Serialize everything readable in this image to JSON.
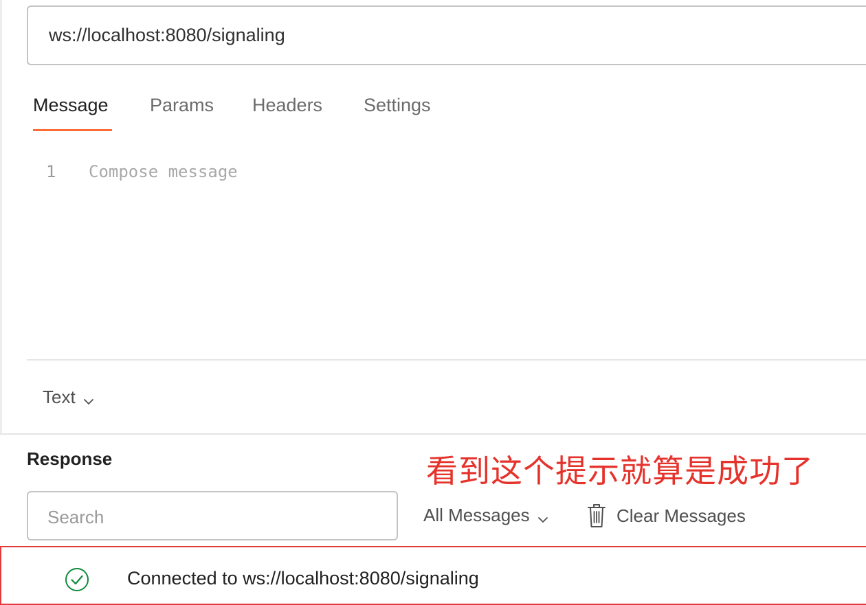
{
  "url_bar": {
    "value": "ws://localhost:8080/signaling"
  },
  "tabs": [
    {
      "label": "Message",
      "active": true
    },
    {
      "label": "Params",
      "active": false
    },
    {
      "label": "Headers",
      "active": false
    },
    {
      "label": "Settings",
      "active": false
    }
  ],
  "editor": {
    "line_number": "1",
    "placeholder": "Compose message"
  },
  "message_format": {
    "selected": "Text"
  },
  "response": {
    "title": "Response",
    "annotation": "看到这个提示就算是成功了",
    "search_placeholder": "Search",
    "filter_selected": "All Messages",
    "clear_label": "Clear Messages",
    "messages": [
      {
        "status": "connected",
        "icon": "check-circle-icon",
        "text": "Connected to ws://localhost:8080/signaling"
      }
    ]
  },
  "colors": {
    "tab_accent": "#ff6c37",
    "annotation_red": "#e5332c",
    "highlight_border": "#e13b3b",
    "success_green": "#0f8a3a"
  }
}
